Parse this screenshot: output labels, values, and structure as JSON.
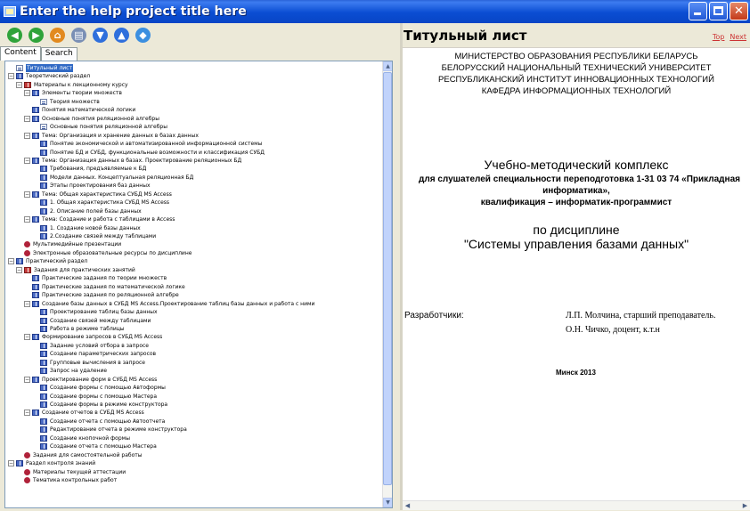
{
  "window": {
    "title": "Enter the help project title here",
    "buttons": {
      "minimize": "_",
      "maximize": "□",
      "close": "✕"
    }
  },
  "toolbar": {
    "buttons": [
      {
        "name": "back-button",
        "icon": "arrow-left-icon",
        "color": "#2fa33a",
        "glyph": "◀"
      },
      {
        "name": "forward-button",
        "icon": "arrow-right-icon",
        "color": "#2fa33a",
        "glyph": "▶"
      },
      {
        "name": "home-button",
        "icon": "home-icon",
        "color": "#e28a1f",
        "glyph": "⌂"
      },
      {
        "name": "print-button",
        "icon": "print-icon",
        "color": "#7a8fb5",
        "glyph": "▤"
      },
      {
        "name": "previous-topic-button",
        "icon": "arrow-down-circle-icon",
        "color": "#2f6fdc",
        "glyph": "▼"
      },
      {
        "name": "next-topic-button",
        "icon": "arrow-up-circle-icon",
        "color": "#2f6fdc",
        "glyph": "▲"
      },
      {
        "name": "sync-toc-button",
        "icon": "sync-icon",
        "color": "#3b8fe0",
        "glyph": "◆"
      }
    ]
  },
  "tabs": [
    "Content",
    "Search"
  ],
  "tree": [
    {
      "level": 0,
      "icon": "page",
      "exp": "",
      "label": "Титульный лист",
      "selected": true
    },
    {
      "level": 0,
      "icon": "book",
      "exp": "−",
      "label": "Теоретический раздел"
    },
    {
      "level": 1,
      "icon": "bookred",
      "exp": "−",
      "label": "Материалы к лекционному курсу"
    },
    {
      "level": 2,
      "icon": "book",
      "exp": "−",
      "label": "Элементы теории множеств"
    },
    {
      "level": 3,
      "icon": "page",
      "exp": "",
      "label": "Теория множеств"
    },
    {
      "level": 2,
      "icon": "book",
      "exp": "",
      "label": "Понятия математической логики"
    },
    {
      "level": 2,
      "icon": "book",
      "exp": "−",
      "label": "Основные понятия реляционной алгебры"
    },
    {
      "level": 3,
      "icon": "page",
      "exp": "",
      "label": "Основные понятия реляционной алгебры"
    },
    {
      "level": 2,
      "icon": "book",
      "exp": "−",
      "label": "Тема: Организация и хранение данных в базах данных"
    },
    {
      "level": 3,
      "icon": "book",
      "exp": "",
      "label": "Понятие экономической и автоматизированной информационной системы"
    },
    {
      "level": 3,
      "icon": "book",
      "exp": "",
      "label": "Понятие БД и СУБД, функциональные возможности и классификация СУБД"
    },
    {
      "level": 2,
      "icon": "book",
      "exp": "−",
      "label": "Тема: Организация данных в базах. Проектирование реляционных БД"
    },
    {
      "level": 3,
      "icon": "book",
      "exp": "",
      "label": "Требования, предъявляемые к БД"
    },
    {
      "level": 3,
      "icon": "book",
      "exp": "",
      "label": "Модели данных. Концептуальная реляционная БД"
    },
    {
      "level": 3,
      "icon": "book",
      "exp": "",
      "label": "Этапы проектирования баз данных"
    },
    {
      "level": 2,
      "icon": "book",
      "exp": "−",
      "label": "Тема: Общая характеристика СУБД MS Access"
    },
    {
      "level": 3,
      "icon": "book",
      "exp": "",
      "label": "1. Общая характеристика СУБД MS Access"
    },
    {
      "level": 3,
      "icon": "book",
      "exp": "",
      "label": "2. Описание полей базы данных"
    },
    {
      "level": 2,
      "icon": "book",
      "exp": "−",
      "label": "Тема: Создание и работа с таблицами в Access"
    },
    {
      "level": 3,
      "icon": "book",
      "exp": "",
      "label": "1. Создание новой базы данных"
    },
    {
      "level": 3,
      "icon": "book",
      "exp": "",
      "label": "2.Создание связей между таблицами"
    },
    {
      "level": 1,
      "icon": "red",
      "exp": "",
      "label": "Мультимедийные презентации"
    },
    {
      "level": 1,
      "icon": "red",
      "exp": "",
      "label": "Электронные образовательные ресурсы по дисциплине"
    },
    {
      "level": 0,
      "icon": "book",
      "exp": "−",
      "label": "Практический раздел"
    },
    {
      "level": 1,
      "icon": "bookred",
      "exp": "−",
      "label": "Задания для практических занятий"
    },
    {
      "level": 2,
      "icon": "book",
      "exp": "",
      "label": "Практические задания по теории множеств"
    },
    {
      "level": 2,
      "icon": "book",
      "exp": "",
      "label": "Практические задания по математической логике"
    },
    {
      "level": 2,
      "icon": "book",
      "exp": "",
      "label": "Практические задания по реляционной алгебре"
    },
    {
      "level": 2,
      "icon": "book",
      "exp": "−",
      "label": "Создание базы данных в СУБД MS Access.Проектирование таблиц базы данных и работа с ними"
    },
    {
      "level": 3,
      "icon": "book",
      "exp": "",
      "label": "Проектирование таблиц базы данных"
    },
    {
      "level": 3,
      "icon": "book",
      "exp": "",
      "label": "Создание связей между таблицами"
    },
    {
      "level": 3,
      "icon": "book",
      "exp": "",
      "label": "Работа в режиме таблицы"
    },
    {
      "level": 2,
      "icon": "book",
      "exp": "−",
      "label": "Формирование запросов в СУБД MS Access"
    },
    {
      "level": 3,
      "icon": "book",
      "exp": "",
      "label": "Задание условий отбора в запросе"
    },
    {
      "level": 3,
      "icon": "book",
      "exp": "",
      "label": "Создание параметрических запросов"
    },
    {
      "level": 3,
      "icon": "book",
      "exp": "",
      "label": "Групповые вычисления в запросе"
    },
    {
      "level": 3,
      "icon": "book",
      "exp": "",
      "label": "Запрос на удаление"
    },
    {
      "level": 2,
      "icon": "book",
      "exp": "−",
      "label": "Проектирование форм в СУБД MS Access"
    },
    {
      "level": 3,
      "icon": "book",
      "exp": "",
      "label": "Создание формы с помощью Автоформы"
    },
    {
      "level": 3,
      "icon": "book",
      "exp": "",
      "label": "Создание формы с помощью Мастера"
    },
    {
      "level": 3,
      "icon": "book",
      "exp": "",
      "label": "Создание формы в режиме конструктора"
    },
    {
      "level": 2,
      "icon": "book",
      "exp": "−",
      "label": "Создание отчетов в СУБД MS Access"
    },
    {
      "level": 3,
      "icon": "book",
      "exp": "",
      "label": "Создание отчета с помощью Автоотчета"
    },
    {
      "level": 3,
      "icon": "book",
      "exp": "",
      "label": "Редактирование отчета в режиме конструктора"
    },
    {
      "level": 3,
      "icon": "book",
      "exp": "",
      "label": "Создание кнопочной формы"
    },
    {
      "level": 3,
      "icon": "book",
      "exp": "",
      "label": "Создание отчета с помощью Мастера"
    },
    {
      "level": 1,
      "icon": "red",
      "exp": "",
      "label": "Задания для самостоятельной работы"
    },
    {
      "level": 0,
      "icon": "book",
      "exp": "−",
      "label": "Раздел контроля знаний"
    },
    {
      "level": 1,
      "icon": "red",
      "exp": "",
      "label": "Материалы текущей аттестации"
    },
    {
      "level": 1,
      "icon": "red",
      "exp": "",
      "label": "Тематика контрольных работ"
    }
  ],
  "topic": {
    "title": "Титульный лист",
    "nav_top": "Top",
    "nav_next": "Next",
    "header_lines": [
      "МИНИСТЕРСТВО ОБРАЗОВАНИЯ РЕСПУБЛИКИ БЕЛАРУСЬ",
      "БЕЛОРУССКИЙ НАЦИОНАЛЬНЫЙ ТЕХНИЧЕСКИЙ УНИВЕРСИТЕТ",
      "РЕСПУБЛИКАНСКИЙ ИНСТИТУТ ИННОВАЦИОННЫХ ТЕХНОЛОГИЙ",
      "КАФЕДРА ИНФОРМАЦИОННЫХ ТЕХНОЛОГИЙ"
    ],
    "complex_title": "Учебно-методический комплекс",
    "audience_line1": "для слушателей специальности переподготовка 1-31 03 74 «Прикладная",
    "audience_line2": "информатика»,",
    "audience_line3": "квалификация – информатик-программист",
    "discipline_label": "по дисциплине",
    "discipline_name": "\"Системы управления базами данных\"",
    "authors_label": "Разработчики:",
    "author1": "Л.П. Молчина, старший преподаватель.",
    "author2": "О.Н. Чичко, доцент, к.т.н",
    "city_year": "Минск 2013"
  }
}
